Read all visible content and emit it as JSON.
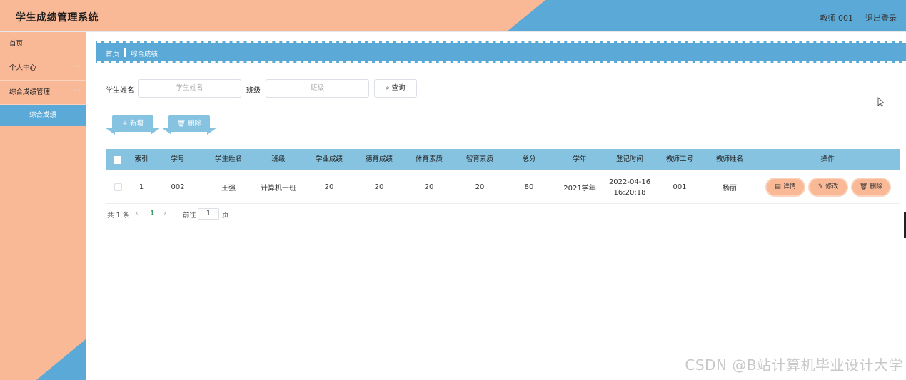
{
  "header": {
    "title": "学生成绩管理系统",
    "user": "教师 001",
    "logout": "退出登录"
  },
  "sidebar": {
    "items": [
      {
        "label": "首页"
      },
      {
        "label": "个人中心",
        "chevron": "﹀"
      },
      {
        "label": "综合成绩管理",
        "chevron": "﹀"
      },
      {
        "label": "综合成绩"
      }
    ]
  },
  "breadcrumb": {
    "home": "首页",
    "current": "综合成绩"
  },
  "search": {
    "name_label": "学生姓名",
    "name_placeholder": "学生姓名",
    "class_label": "班级",
    "class_placeholder": "班级",
    "query_label": "查询"
  },
  "actions": {
    "add_label": "新增",
    "delete_label": "删除"
  },
  "table": {
    "headers": [
      "索引",
      "学号",
      "学生姓名",
      "班级",
      "学业成绩",
      "德育成绩",
      "体育素质",
      "智育素质",
      "总分",
      "学年",
      "登记时间",
      "教师工号",
      "教师姓名",
      "操作"
    ],
    "rows": [
      {
        "index": "1",
        "student_no": "002",
        "student_name": "王强",
        "class": "计算机一班",
        "academic": "20",
        "moral": "20",
        "physical": "20",
        "intellectual": "20",
        "total": "80",
        "year": "2021学年",
        "reg_date": "2022-04-16",
        "reg_time": "16:20:18",
        "teacher_no": "001",
        "teacher_name": "杨丽",
        "ops": {
          "detail": "详情",
          "edit": "修改",
          "delete": "删除"
        }
      }
    ]
  },
  "pagination": {
    "total": "共 1 条",
    "prev": "‹",
    "page": "1",
    "next": "›",
    "goto_label": "前往",
    "goto_value": "1",
    "page_suffix": "页"
  },
  "watermark": "CSDN @B站计算机毕业设计大学",
  "colors": {
    "peach": "#f9b896",
    "blue": "#5ba9d6",
    "light_blue": "#86c3e0"
  }
}
